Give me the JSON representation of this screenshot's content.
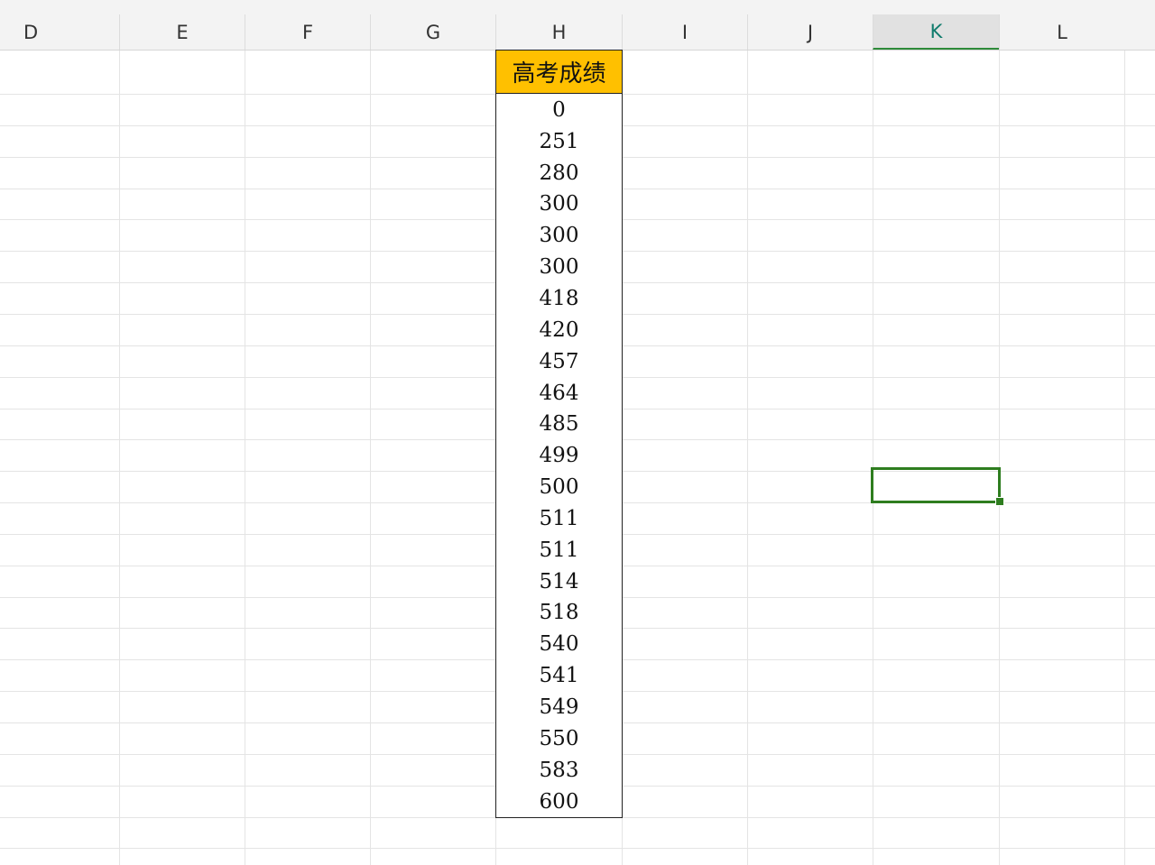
{
  "columns": [
    "D",
    "E",
    "F",
    "G",
    "H",
    "I",
    "J",
    "K",
    "L"
  ],
  "active_column": "K",
  "table": {
    "header": "高考成绩",
    "header_color": "#ffc000",
    "values": [
      "0",
      "251",
      "280",
      "300",
      "300",
      "300",
      "418",
      "420",
      "457",
      "464",
      "485",
      "499",
      "500",
      "511",
      "511",
      "514",
      "518",
      "540",
      "541",
      "549",
      "550",
      "583",
      "600"
    ]
  },
  "selection_color": "#2e7d1f"
}
